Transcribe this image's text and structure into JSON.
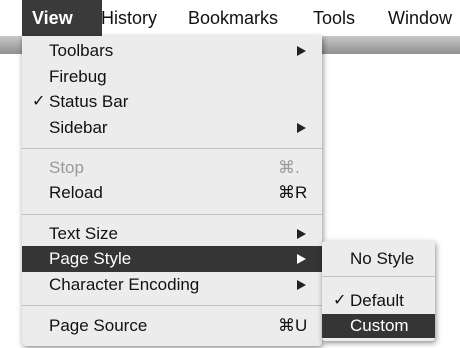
{
  "menubar": {
    "items": [
      {
        "label": "View",
        "active": true
      },
      {
        "label": "History",
        "active": false
      },
      {
        "label": "Bookmarks",
        "active": false
      },
      {
        "label": "Tools",
        "active": false
      },
      {
        "label": "Window",
        "active": false
      }
    ]
  },
  "view_menu": {
    "items": [
      {
        "label": "Toolbars",
        "submenu": true,
        "enabled": true
      },
      {
        "label": "Firebug",
        "enabled": true
      },
      {
        "label": "Status Bar",
        "checked": true,
        "check_mark": "✓",
        "enabled": true
      },
      {
        "label": "Sidebar",
        "submenu": true,
        "enabled": true
      },
      {
        "label": "Stop",
        "shortcut": "⌘.",
        "enabled": false
      },
      {
        "label": "Reload",
        "shortcut": "⌘R",
        "enabled": true
      },
      {
        "label": "Text Size",
        "submenu": true,
        "enabled": true
      },
      {
        "label": "Page Style",
        "submenu": true,
        "enabled": true,
        "highlighted": true
      },
      {
        "label": "Character Encoding",
        "submenu": true,
        "enabled": true
      },
      {
        "label": "Page Source",
        "shortcut": "⌘U",
        "enabled": true
      }
    ]
  },
  "page_style_submenu": {
    "items": [
      {
        "label": "No Style"
      },
      {
        "label": "Default",
        "checked": true,
        "check_mark": "✓"
      },
      {
        "label": "Custom",
        "highlighted": true
      }
    ]
  },
  "colors": {
    "menu_background": "#ececec",
    "highlight": "#353535",
    "highlight_text": "#ffffff",
    "disabled_text": "#9a9a9a"
  }
}
